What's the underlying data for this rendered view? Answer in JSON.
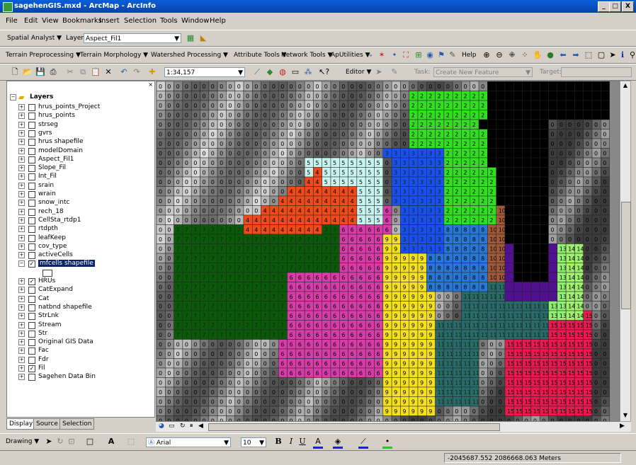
{
  "window": {
    "title": "sagehenGIS.mxd - ArcMap - ArcInfo",
    "min": "_",
    "max": "□",
    "close": "X"
  },
  "menu": [
    "File",
    "Edit",
    "View",
    "Bookmarks",
    "Insert",
    "Selection",
    "Tools",
    "Window",
    "Help"
  ],
  "spatial_toolbar": {
    "spatial_analyst": "Spatial Analyst ▼",
    "layer_label": "Layer:",
    "layer_value": "Aspect_Fil1"
  },
  "hydro_toolbar": {
    "terrain_pre": "Terrain Preprocessing ▼",
    "terrain_morph": "Terrain Morphology ▼",
    "watershed": "Watershed Processing ▼",
    "attribute": "Attribute Tools ▼",
    "network": "Network Tools ▼",
    "aputilities": "ApUtilities ▼",
    "help": "Help"
  },
  "standard_toolbar": {
    "scale": "1:34,157",
    "editor": "Editor ▼",
    "task_label": "Task:",
    "task_value": "Create New Feature",
    "target_label": "Target:"
  },
  "toc": {
    "root": "Layers",
    "layers": [
      {
        "name": "hrus_points_Project",
        "checked": false
      },
      {
        "name": "hrus_points",
        "checked": false
      },
      {
        "name": "strseg",
        "checked": false
      },
      {
        "name": "gvrs",
        "checked": false
      },
      {
        "name": "hrus shapefile",
        "checked": false
      },
      {
        "name": "modelDomain",
        "checked": false
      },
      {
        "name": "Aspect_Fil1",
        "checked": false
      },
      {
        "name": "Slope_Fil",
        "checked": false
      },
      {
        "name": "Int_Fil",
        "checked": false
      },
      {
        "name": "srain",
        "checked": false
      },
      {
        "name": "wrain",
        "checked": false
      },
      {
        "name": "snow_intc",
        "checked": false
      },
      {
        "name": "rech_18",
        "checked": false
      },
      {
        "name": "CellSta_rtdp1",
        "checked": false
      },
      {
        "name": "rtdpth",
        "checked": false
      },
      {
        "name": "leafKeep",
        "checked": false
      },
      {
        "name": "cov_type",
        "checked": false
      },
      {
        "name": "activeCells",
        "checked": false
      },
      {
        "name": "mfcells shapefile",
        "checked": true,
        "selected": true
      },
      {
        "name": "",
        "legend": true
      },
      {
        "name": "HRUs",
        "checked": true
      },
      {
        "name": "CatExpand",
        "checked": false
      },
      {
        "name": "Cat",
        "checked": false
      },
      {
        "name": "natbnd shapefile",
        "checked": false
      },
      {
        "name": "StrLnk",
        "checked": false
      },
      {
        "name": "Stream",
        "checked": false
      },
      {
        "name": "Str",
        "checked": false
      },
      {
        "name": "Original GIS Data",
        "checked": false
      },
      {
        "name": "Fac",
        "checked": false
      },
      {
        "name": "Fdr",
        "checked": false
      },
      {
        "name": "Fil",
        "checked": true
      },
      {
        "name": "Sagehen Data Bin",
        "checked": false
      }
    ],
    "tabs": [
      "Display",
      "Source",
      "Selection"
    ]
  },
  "map": {
    "colors": {
      "0": "#a8a8a8",
      "2": "#33dd22",
      "3": "#1a4ff0",
      "4": "#f04a1a",
      "5": "#c8f4f0",
      "6": "#d83ca8",
      "7": "#0a5a0a",
      "8": "#2878d8",
      "9": "#f4e020",
      "10": "#a05a3a",
      "11": "#2a6a6a",
      "13": "#90f070",
      "14": "#a0f070",
      "15": "#e81a50",
      "black": "#000000",
      "purple": "#501090"
    }
  },
  "drawing_toolbar": {
    "drawing": "Drawing ▼",
    "font": "Arial",
    "size": "10",
    "bold": "B",
    "italic": "I",
    "underline": "U"
  },
  "status": {
    "coords": "-2045687.552  2086668.063 Meters"
  }
}
